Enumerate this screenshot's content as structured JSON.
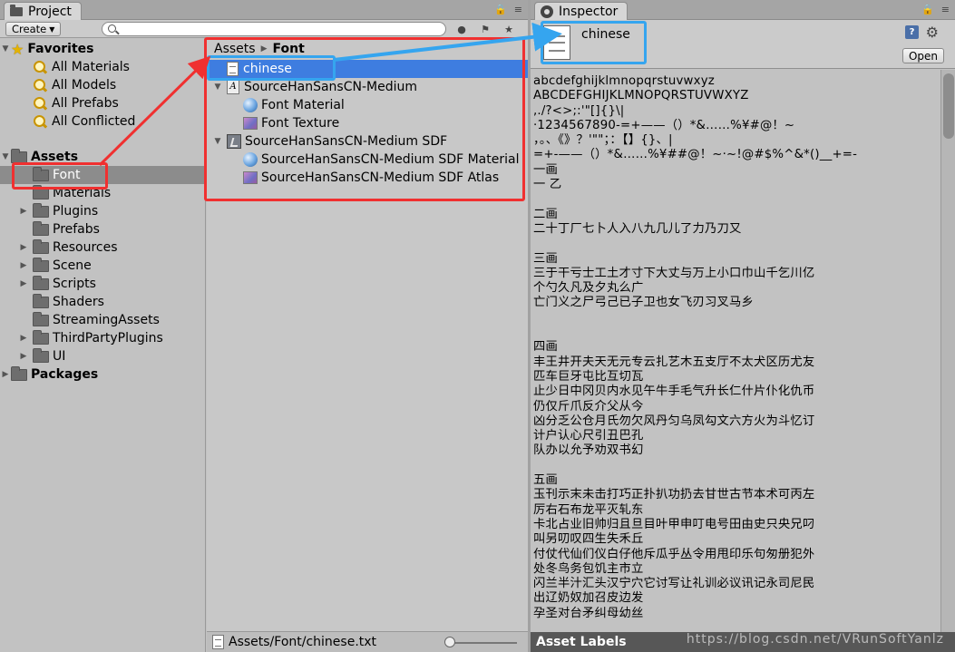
{
  "project": {
    "tab_label": "Project",
    "create_label": "Create",
    "favorites": {
      "label": "Favorites",
      "items": [
        "All Materials",
        "All Models",
        "All Prefabs",
        "All Conflicted"
      ]
    },
    "assets": {
      "label": "Assets",
      "items": [
        "Font",
        "Materials",
        "Plugins",
        "Prefabs",
        "Resources",
        "Scene",
        "Scripts",
        "Shaders",
        "StreamingAssets",
        "ThirdPartyPlugins",
        "UI"
      ]
    },
    "packages_label": "Packages",
    "breadcrumb": [
      "Assets",
      "Font"
    ],
    "files": [
      "chinese",
      "SourceHanSansCN-Medium",
      "Font Material",
      "Font Texture",
      "SourceHanSansCN-Medium SDF",
      "SourceHanSansCN-Medium SDF Material",
      "SourceHanSansCN-Medium SDF Atlas"
    ],
    "status_path": "Assets/Font/chinese.txt"
  },
  "inspector": {
    "tab_label": "Inspector",
    "title": "chinese",
    "open_label": "Open",
    "help_label": "?",
    "text_content": "abcdefghijklmnopqrstuvwxyz\nABCDEFGHIJKLMNOPQRSTUVWXYZ\n,./?<>;:'\"[]{}\\|\n·1234567890-=+——（）*&……%¥#@！~\n，。、《》？'\"\"；：【】{}、|\n=+-——（）*&……%¥##@！~·~!@#$%^&*()__+=-\n一画\n一 乙\n\n二画\n二十丁厂七卜人入八九几儿了力乃刀又\n\n三画\n三于干亏士工土才寸下大丈与万上小口巾山千乞川亿\n个勺久凡及夕丸么广\n亡门义之尸弓己已子卫也女飞刃习叉马乡\n\n\n四画\n丰王井开夫天无元专云扎艺木五支厅不太犬区历尤友\n匹车巨牙屯比互切瓦\n止少日中冈贝内水见午牛手毛气升长仁什片仆化仇币\n仍仅斤爪反介父从今\n凶分乏公仓月氏勿欠风丹匀乌凤勾文六方火为斗忆订\n计户认心尺引丑巴孔\n队办以允予劝双书幻\n\n五画\n玉刊示末未击打巧正扑扒功扔去甘世古节本术可丙左\n厉右石布龙平灭轧东\n卡北占业旧帅归且旦目叶甲申叮电号田由史只央兄叼\n叫另叨叹四生失禾丘\n付仗代仙们仪白仔他斥瓜乎丛令用甩印乐句匆册犯外\n处冬鸟务包饥主市立\n闪兰半汁汇头汉宁穴它讨写让礼训必议讯记永司尼民\n出辽奶奴加召皮边发\n孕圣对台矛纠母幼丝\n\n六画",
    "asset_labels": "Asset Labels",
    "watermark": "https://blog.csdn.net/VRunSoftYanlz"
  },
  "colors": {
    "selection_blue": "#3e7de0",
    "annotation_red": "#f03030",
    "annotation_blue": "#35a5ef"
  }
}
